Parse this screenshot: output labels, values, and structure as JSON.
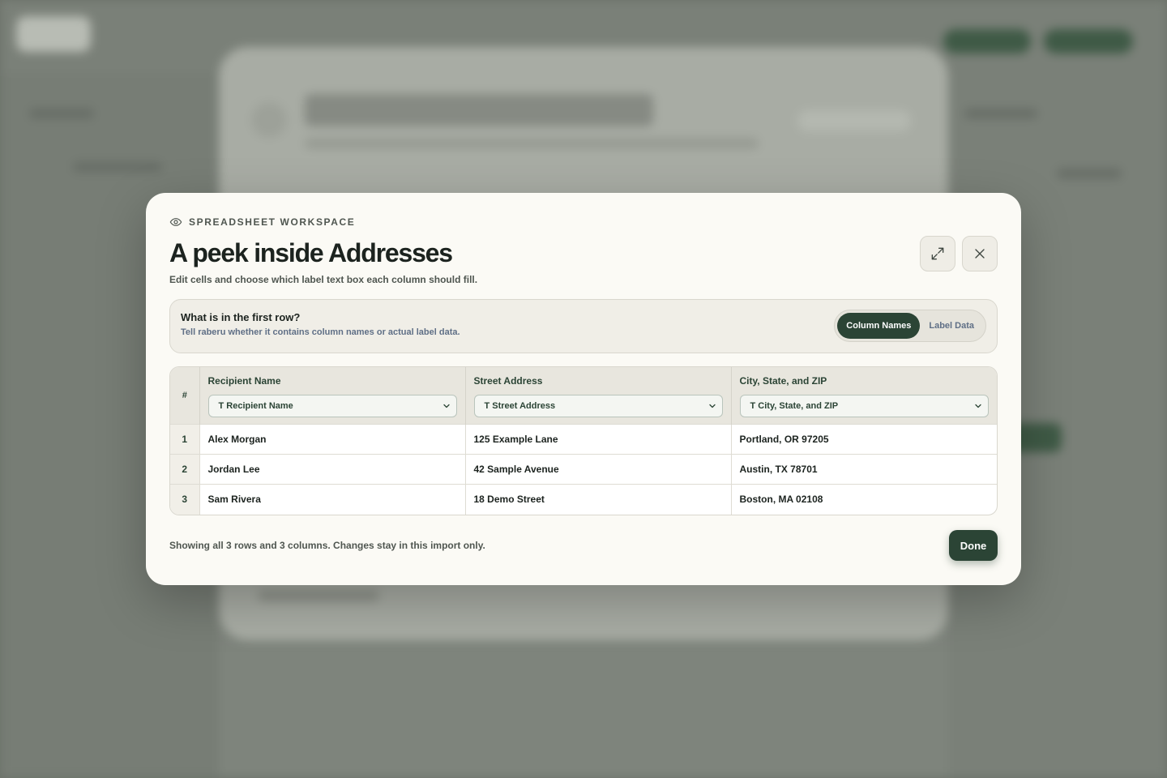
{
  "modal": {
    "eyebrow": "SPREADSHEET WORKSPACE",
    "title": "A peek inside Addresses",
    "subtitle": "Edit cells and choose which label text box each column should fill.",
    "expand_icon": "expand-icon",
    "close_icon": "close-icon"
  },
  "first_row": {
    "question": "What is in the first row?",
    "description": "Tell raberu whether it contains column names or actual label data.",
    "options": [
      "Column Names",
      "Label Data"
    ],
    "selected": "Column Names"
  },
  "table": {
    "index_header": "#",
    "columns": [
      {
        "name": "Recipient Name",
        "mapping": "T Recipient Name"
      },
      {
        "name": "Street Address",
        "mapping": "T Street Address"
      },
      {
        "name": "City, State, and ZIP",
        "mapping": "T City, State, and ZIP"
      }
    ],
    "rows": [
      {
        "index": "1",
        "cells": [
          "Alex Morgan",
          "125 Example Lane",
          "Portland, OR 97205"
        ]
      },
      {
        "index": "2",
        "cells": [
          "Jordan Lee",
          "42 Sample Avenue",
          "Austin, TX 78701"
        ]
      },
      {
        "index": "3",
        "cells": [
          "Sam Rivera",
          "18 Demo Street",
          "Boston, MA 02108"
        ]
      }
    ]
  },
  "footer": {
    "summary": "Showing all 3 rows and 3 columns. Changes stay in this import only.",
    "done_label": "Done"
  },
  "colors": {
    "accent": "#2b4435",
    "modal_bg": "#fbfaf5",
    "overlay": "#6b7169"
  }
}
